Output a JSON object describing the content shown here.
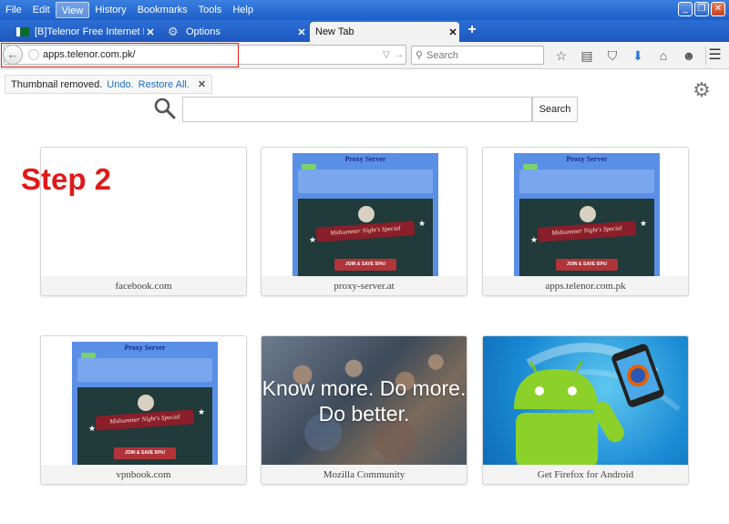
{
  "menubar": {
    "items": [
      "File",
      "Edit",
      "View",
      "History",
      "Bookmarks",
      "Tools",
      "Help"
    ],
    "active_item": "View",
    "window_controls": {
      "minimize": "_",
      "restore": "❐",
      "close": "✕"
    }
  },
  "tabs": [
    {
      "label": "[B]Telenor Free Internet Prox...",
      "icon": "pakistan-flag-icon",
      "close": "✕"
    },
    {
      "label": "Options",
      "icon": "gear-icon",
      "close": "✕"
    },
    {
      "label": "New Tab",
      "icon": "",
      "close": "✕",
      "selected": true
    }
  ],
  "new_tab_button": "+",
  "navbar": {
    "url": "apps.telenor.com.pk/",
    "url_controls": {
      "dropdown": "▽",
      "reload": "→"
    },
    "search_placeholder": "Search",
    "tool_icons": [
      "star-icon",
      "clipboard-icon",
      "pocket-icon",
      "download-icon",
      "home-icon",
      "chat-icon"
    ],
    "menu_icon": "hamburger-icon"
  },
  "notification": {
    "text": "Thumbnail removed.",
    "undo": "Undo.",
    "restore_all": "Restore All.",
    "close": "✕"
  },
  "page_search": {
    "button_label": "Search",
    "value": ""
  },
  "annotation": {
    "step_label": "Step 2"
  },
  "tiles": [
    {
      "caption": "facebook.com",
      "thumb": "blank"
    },
    {
      "caption": "proxy-server.at",
      "thumb": "proxy"
    },
    {
      "caption": "apps.telenor.com.pk",
      "thumb": "proxy"
    },
    {
      "caption": "vpnbook.com",
      "thumb": "proxy"
    },
    {
      "caption": "Mozilla Community",
      "thumb": "mozilla"
    },
    {
      "caption": "Get Firefox for Android",
      "thumb": "android"
    }
  ],
  "proxy_thumb": {
    "title": "Proxy Server",
    "ribbon": "Midsummer Night's Special",
    "cta": "JOIN & SAVE 50%!"
  },
  "mozilla_thumb": {
    "line1": "Know more. Do more.",
    "line2": "Do better."
  },
  "colors": {
    "title_bar": "#1b5fc9",
    "step_label": "#e01a1a",
    "link": "#1f6fbf",
    "highlight_box": "#e02020"
  }
}
